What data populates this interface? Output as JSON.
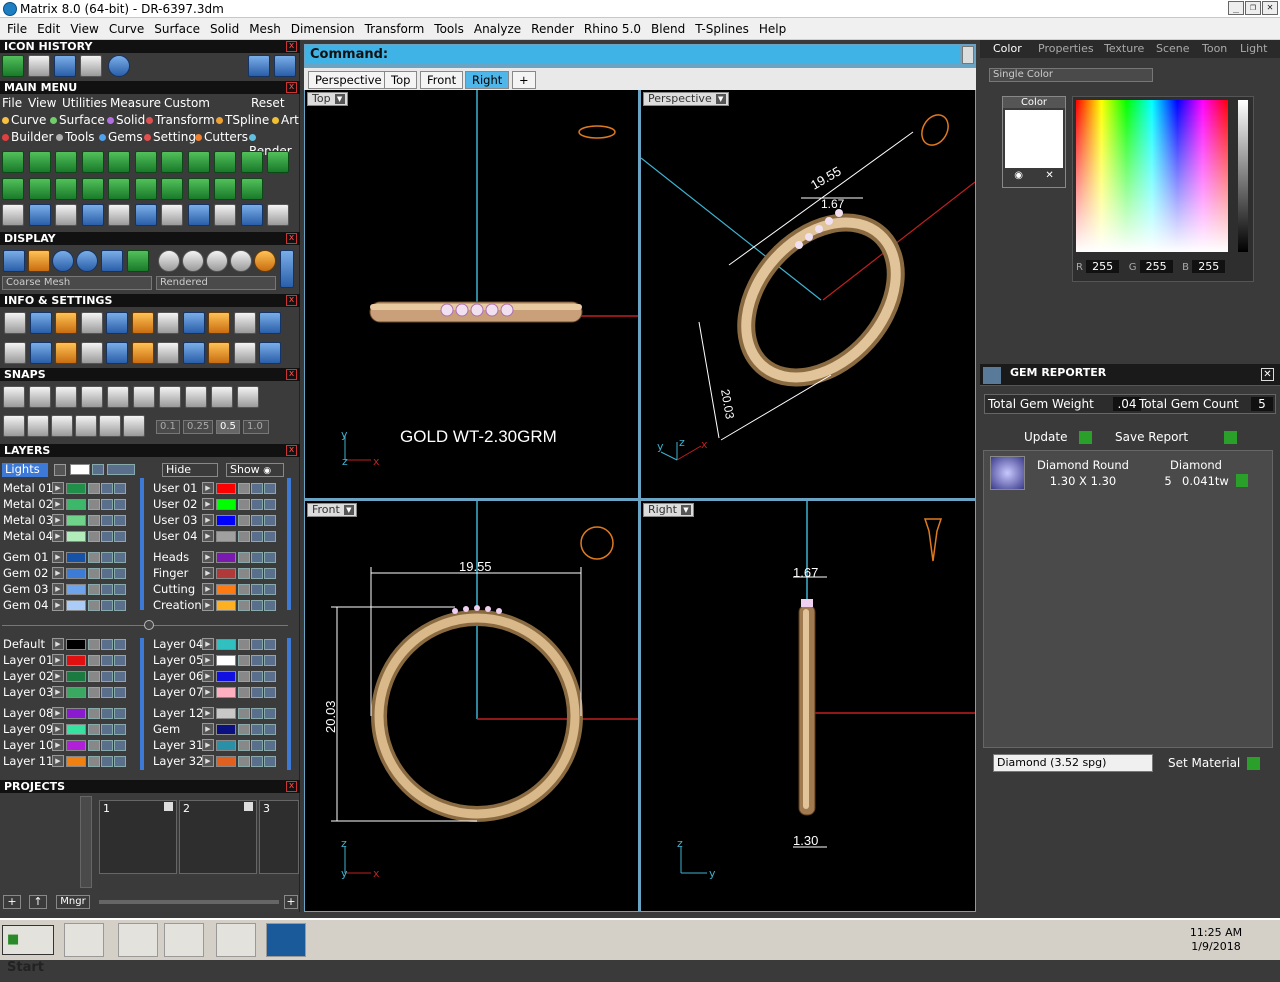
{
  "window": {
    "title": "Matrix 8.0 (64-bit) - DR-6397.3dm"
  },
  "menubar": [
    "File",
    "Edit",
    "View",
    "Curve",
    "Surface",
    "Solid",
    "Mesh",
    "Dimension",
    "Transform",
    "Tools",
    "Analyze",
    "Render",
    "Rhino 5.0",
    "Blend",
    "T-Splines",
    "Help"
  ],
  "left": {
    "icon_history": "ICON HISTORY",
    "main_menu": "MAIN MENU",
    "mm_menu": [
      "File",
      "View",
      "Utilities",
      "Measure",
      "Custom"
    ],
    "mm_reset": "Reset",
    "mm_cat1": [
      "Curve",
      "Surface",
      "Solid",
      "Transform",
      "TSpline",
      "Art"
    ],
    "mm_cat2": [
      "Builder",
      "Tools",
      "Gems",
      "Setting",
      "Cutters",
      "Render"
    ],
    "display": "DISPLAY",
    "display_mesh": "Coarse Mesh",
    "display_mode": "Rendered",
    "info_settings": "INFO & SETTINGS",
    "snaps": "SNAPS",
    "snap_values": [
      "0.1",
      "0.25",
      "0.5",
      "1.0"
    ],
    "layers": "LAYERS",
    "lights": "Lights",
    "hide": "Hide",
    "show": "Show",
    "layers_left": [
      {
        "name": "Metal 01",
        "color": "#1f8f4a"
      },
      {
        "name": "Metal 02",
        "color": "#3db76a"
      },
      {
        "name": "Metal 03",
        "color": "#6fd38a"
      },
      {
        "name": "Metal 04",
        "color": "#b2ecbb"
      },
      {
        "name": "Gem 01",
        "color": "#1652a8"
      },
      {
        "name": "Gem 02",
        "color": "#3c7bd6"
      },
      {
        "name": "Gem 03",
        "color": "#6ea4ec"
      },
      {
        "name": "Gem 04",
        "color": "#aaccf6"
      },
      {
        "name": "Default",
        "color": "#000000"
      },
      {
        "name": "Layer 01",
        "color": "#e01010"
      },
      {
        "name": "Layer 02",
        "color": "#1a7a40"
      },
      {
        "name": "Layer 03",
        "color": "#3aa860"
      },
      {
        "name": "Layer 08",
        "color": "#8a1ad0"
      },
      {
        "name": "Layer 09",
        "color": "#36e2a0"
      },
      {
        "name": "Layer 10",
        "color": "#b020d8"
      },
      {
        "name": "Layer 11",
        "color": "#f08010"
      }
    ],
    "layers_right": [
      {
        "name": "User 01",
        "color": "#ff0000"
      },
      {
        "name": "User 02",
        "color": "#00ff00"
      },
      {
        "name": "User 03",
        "color": "#0000ff"
      },
      {
        "name": "User 04",
        "color": "#a0a0a0"
      },
      {
        "name": "Heads",
        "color": "#7a1ab0"
      },
      {
        "name": "Finger",
        "color": "#b03a3a"
      },
      {
        "name": "Cutting",
        "color": "#ff7a10"
      },
      {
        "name": "Creation",
        "color": "#ffb020"
      },
      {
        "name": "Layer 04",
        "color": "#30c0c0"
      },
      {
        "name": "Layer 05",
        "color": "#ffffff"
      },
      {
        "name": "Layer 06",
        "color": "#1010e0"
      },
      {
        "name": "Layer 07",
        "color": "#ffb0c0"
      },
      {
        "name": "Layer 12",
        "color": "#c8c8c8"
      },
      {
        "name": "Gem",
        "color": "#0a1080"
      },
      {
        "name": "Layer 31",
        "color": "#2a90a8"
      },
      {
        "name": "Layer 32",
        "color": "#e06020"
      }
    ],
    "projects": "PROJECTS",
    "project_slots": [
      "1",
      "2",
      "3"
    ],
    "mngr": "Mngr"
  },
  "command": {
    "label": "Command:"
  },
  "view_tabs": [
    "Perspective",
    "Top",
    "Front",
    "Right"
  ],
  "viewports": {
    "top": {
      "label": "Top",
      "note": "GOLD WT-2.30GRM"
    },
    "perspective": {
      "label": "Perspective",
      "dim1": "19.55",
      "dim2": "1.67",
      "dim3": "20.03"
    },
    "front": {
      "label": "Front",
      "dim_w": "19.55",
      "dim_h": "20.03"
    },
    "right": {
      "label": "Right",
      "dim_top": "1.67",
      "dim_bot": "1.30"
    }
  },
  "axes": {
    "x": "x",
    "y": "y",
    "z": "z"
  },
  "right": {
    "tabs": [
      "Color",
      "Properties",
      "Texture",
      "Scene",
      "Toon",
      "Light"
    ],
    "color_mode": "Single Color",
    "color_label": "Color",
    "rgb": {
      "r_label": "R",
      "r": "255",
      "g_label": "G",
      "g": "255",
      "b_label": "B",
      "b": "255"
    },
    "gem_reporter": {
      "title": "GEM REPORTER",
      "weight_label": "Total Gem Weight",
      "weight": ".04",
      "count_label": "Total Gem Count",
      "count": "5",
      "update": "Update",
      "save": "Save Report",
      "row": {
        "name": "Diamond Round",
        "size": "1.30 X 1.30",
        "type": "Diamond",
        "qty": "5",
        "tw": "0.041tw"
      },
      "material": "Diamond    (3.52 spg)",
      "set_material": "Set Material"
    }
  },
  "taskbar": {
    "start": "Start",
    "time": "11:25 AM",
    "date": "1/9/2018"
  }
}
